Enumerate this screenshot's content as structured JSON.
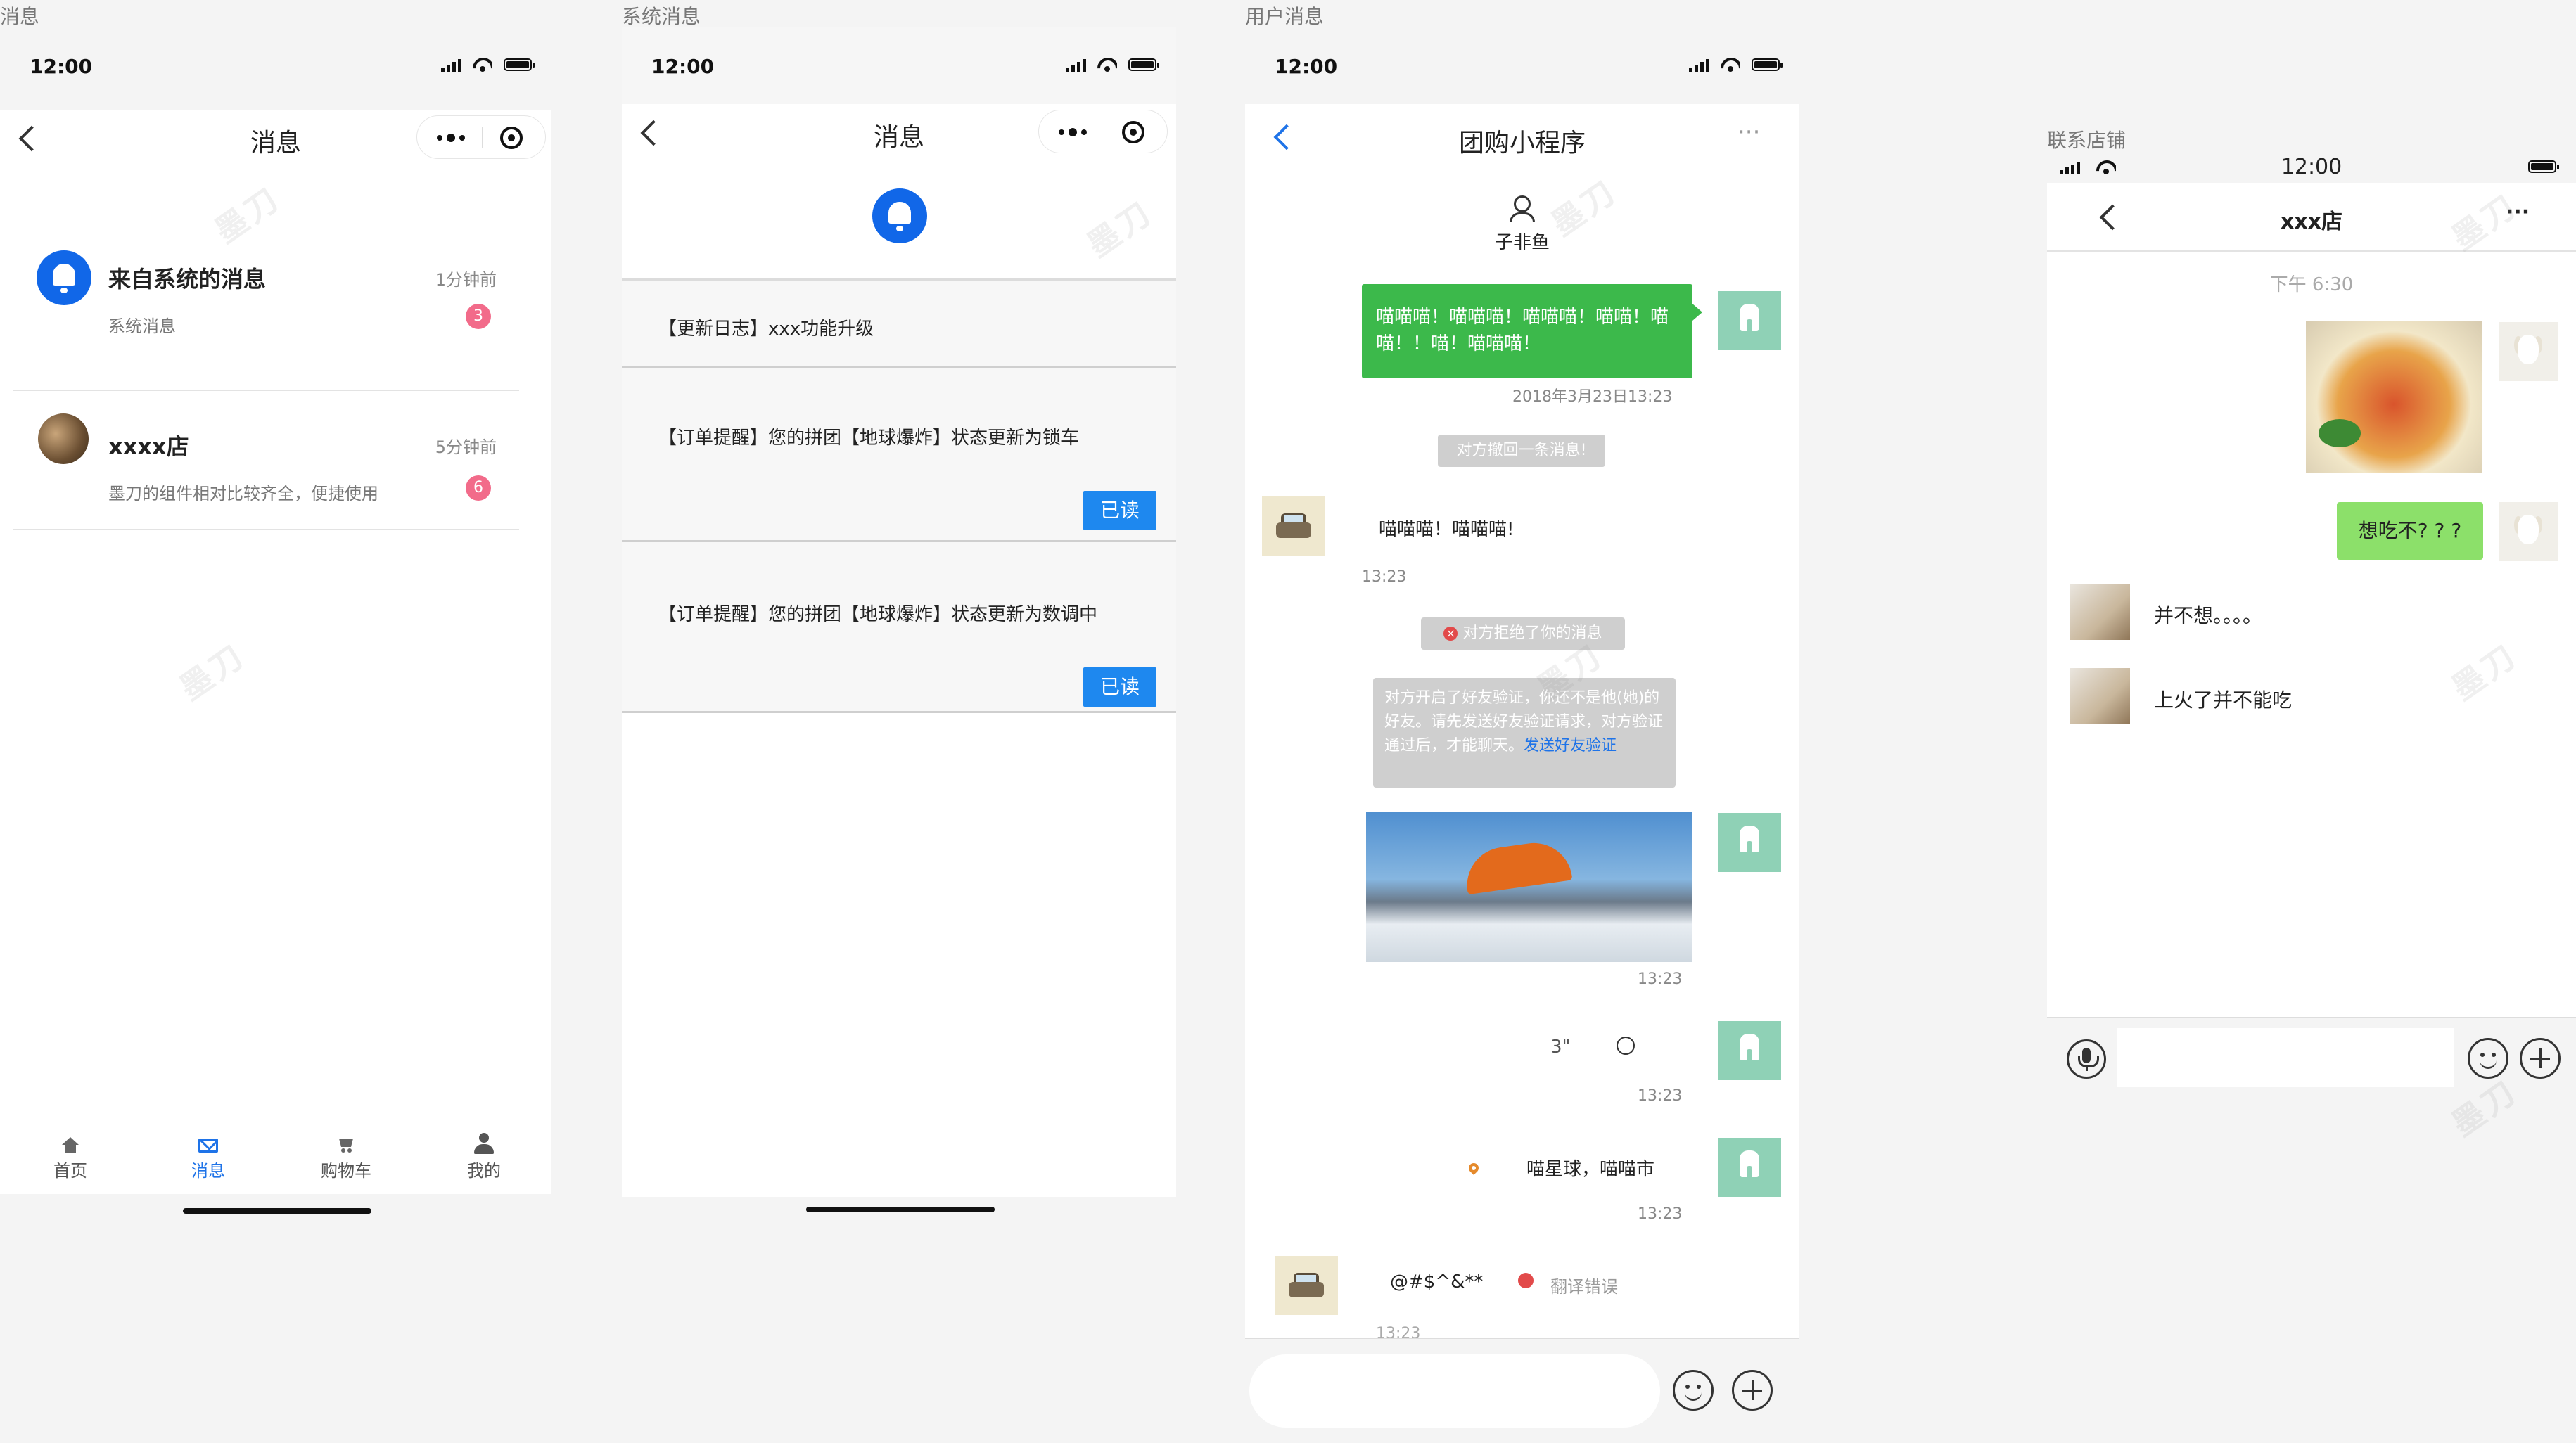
{
  "status": {
    "time": "12:00"
  },
  "screen1": {
    "caption": "消息",
    "title": "消息",
    "items": [
      {
        "title": "来自系统的消息",
        "sub": "系统消息",
        "time": "1分钟前",
        "badge": "3"
      },
      {
        "title": "xxxx店",
        "sub": "墨刀的组件相对比较齐全，便捷使用",
        "time": "5分钟前",
        "badge": "6"
      }
    ],
    "tabs": [
      {
        "label": "首页",
        "icon": "home-icon"
      },
      {
        "label": "消息",
        "icon": "envelope-icon"
      },
      {
        "label": "购物车",
        "icon": "cart-icon"
      },
      {
        "label": "我的",
        "icon": "user-icon"
      }
    ],
    "accent": "#1167e8"
  },
  "screen2": {
    "caption": "系统消息",
    "title": "消息",
    "messages": [
      {
        "text": "【更新日志】xxx功能升级"
      },
      {
        "text": "【订单提醒】您的拼团【地球爆炸】状态更新为锁车",
        "button": "已读"
      },
      {
        "text": "【订单提醒】您的拼团【地球爆炸】状态更新为数调中",
        "button": "已读"
      }
    ]
  },
  "screen3": {
    "caption": "用户消息",
    "title": "团购小程序",
    "more": "···",
    "contact": "子非鱼",
    "green_msg": "喵喵喵！喵喵喵！喵喵喵！喵喵！喵喵！！喵！喵喵喵！",
    "green_time": "2018年3月23日13:23",
    "recall": "对方撤回一条消息!",
    "left_msg": "喵喵喵！喵喵喵!",
    "left_time": "13:23",
    "rejected": "对方拒绝了你的消息",
    "verify_text": "对方开启了好友验证，你还不是他(她)的好友。请先发送好友验证请求，对方验证通过后，才能聊天。",
    "verify_link": "发送好友验证",
    "img_time": "13:23",
    "voice": "3\"",
    "voice_time": "13:23",
    "location": "喵星球，喵喵市",
    "loc_time": "13:23",
    "garbled": "@#$^&**",
    "translate_err": "翻译错误",
    "last_time": "13:23"
  },
  "screen4": {
    "caption": "联系店铺",
    "time": "12:00",
    "title": "xxx店",
    "more": "···",
    "date": "下午 6:30",
    "my_msg": "想吃不? ? ?",
    "their_msgs": [
      "并不想。。。。",
      "上火了并不能吃"
    ]
  },
  "watermark_text": "墨刀"
}
